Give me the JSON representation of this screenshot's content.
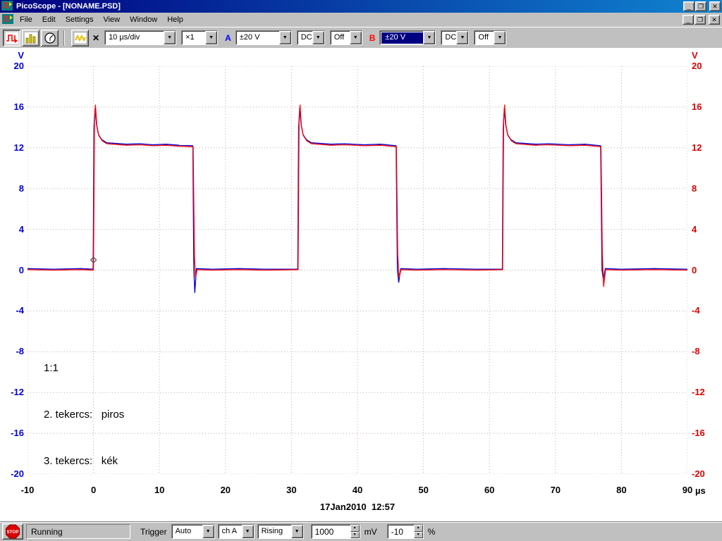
{
  "window": {
    "title": "PicoScope - [NONAME.PSD]",
    "minimize_glyph": "_",
    "restore_glyph": "❐",
    "close_glyph": "✕"
  },
  "menu": {
    "items": [
      "File",
      "Edit",
      "Settings",
      "View",
      "Window",
      "Help"
    ]
  },
  "toolbar": {
    "x_label": "✕",
    "timebase": "10 µs/div",
    "multiplier": "×1",
    "channel_a": {
      "label": "A",
      "range": "±20 V",
      "coupling": "DC",
      "mode": "Off"
    },
    "channel_b": {
      "label": "B",
      "range": "±20 V",
      "coupling": "DC",
      "mode": "Off"
    }
  },
  "scope": {
    "left_axis_unit": "V",
    "right_axis_unit": "V",
    "x_axis_unit": "µs",
    "timestamp": "17Jan2010  12:57",
    "annotation_lines": [
      "1:1",
      "2. tekercs:   piros",
      "3. tekercs:   kék"
    ]
  },
  "statusbar": {
    "stop_label": "STOP",
    "status": "Running",
    "trigger_label": "Trigger",
    "trigger_mode": "Auto",
    "trigger_source": "ch A",
    "trigger_direction": "Rising",
    "trigger_threshold": "1000",
    "threshold_unit": "mV",
    "trigger_delay": "-10",
    "delay_unit": "%"
  },
  "ui": {
    "dropdown_arrow": "▼",
    "spin_up": "▲",
    "spin_down": "▼",
    "titlebar_gradient": [
      "#000080",
      "#1084d0"
    ],
    "channel_a_color": "#0000ff",
    "channel_b_color": "#ff0000",
    "grid_color": "#c9a9a9"
  },
  "chart_data": {
    "type": "line",
    "title": "",
    "xlabel": "µs",
    "ylabel": "V",
    "xlim": [
      -10,
      90
    ],
    "ylim": [
      -20,
      20
    ],
    "x_ticks": [
      -10,
      0,
      10,
      20,
      30,
      40,
      50,
      60,
      70,
      80,
      90
    ],
    "y_ticks": [
      20,
      16,
      12,
      8,
      4,
      0,
      -4,
      -8,
      -12,
      -16,
      -20
    ],
    "grid": "dotted",
    "legend": "none",
    "trigger_marker": {
      "x": 0,
      "y": 1
    },
    "series": [
      {
        "name": "3. tekercs (kék)",
        "color": "#0000cc",
        "points": [
          [
            -10,
            0.15
          ],
          [
            -6,
            0.1
          ],
          [
            -2,
            0.15
          ],
          [
            -0.05,
            0.1
          ],
          [
            0.08,
            14
          ],
          [
            0.25,
            15.9
          ],
          [
            0.45,
            14.3
          ],
          [
            0.75,
            13.3
          ],
          [
            1.25,
            12.8
          ],
          [
            2,
            12.5
          ],
          [
            3,
            12.45
          ],
          [
            5,
            12.35
          ],
          [
            7,
            12.4
          ],
          [
            9,
            12.3
          ],
          [
            11,
            12.35
          ],
          [
            13,
            12.25
          ],
          [
            15.05,
            12.2
          ],
          [
            15.2,
            0
          ],
          [
            15.35,
            -2.2
          ],
          [
            15.6,
            0.15
          ],
          [
            18,
            0.1
          ],
          [
            22,
            0.15
          ],
          [
            26,
            0.1
          ],
          [
            30.95,
            0.1
          ],
          [
            31.08,
            14
          ],
          [
            31.25,
            15.9
          ],
          [
            31.45,
            14.3
          ],
          [
            31.75,
            13.3
          ],
          [
            32.25,
            12.8
          ],
          [
            33,
            12.5
          ],
          [
            34,
            12.45
          ],
          [
            36,
            12.35
          ],
          [
            38,
            12.4
          ],
          [
            41,
            12.3
          ],
          [
            43.5,
            12.35
          ],
          [
            45.85,
            12.2
          ],
          [
            46.05,
            0
          ],
          [
            46.25,
            -1.2
          ],
          [
            46.55,
            0.15
          ],
          [
            49,
            0.1
          ],
          [
            53,
            0.15
          ],
          [
            58,
            0.1
          ],
          [
            61.95,
            0.1
          ],
          [
            62.08,
            14
          ],
          [
            62.25,
            15.9
          ],
          [
            62.45,
            14.3
          ],
          [
            62.75,
            13.3
          ],
          [
            63.25,
            12.8
          ],
          [
            64,
            12.5
          ],
          [
            65,
            12.45
          ],
          [
            67,
            12.35
          ],
          [
            69,
            12.4
          ],
          [
            72,
            12.3
          ],
          [
            74.5,
            12.35
          ],
          [
            76.85,
            12.2
          ],
          [
            77.05,
            0
          ],
          [
            77.25,
            -0.9
          ],
          [
            77.55,
            0.15
          ],
          [
            80,
            0.1
          ],
          [
            85,
            0.15
          ],
          [
            90,
            0.1
          ]
        ]
      },
      {
        "name": "2. tekercs (piros)",
        "color": "#ff0000",
        "points": [
          [
            -10,
            0.05
          ],
          [
            -6,
            0
          ],
          [
            -2,
            0.05
          ],
          [
            0,
            0
          ],
          [
            0.15,
            14.5
          ],
          [
            0.3,
            16.2
          ],
          [
            0.5,
            14.2
          ],
          [
            0.8,
            13.2
          ],
          [
            1.3,
            12.7
          ],
          [
            2,
            12.4
          ],
          [
            3,
            12.35
          ],
          [
            5,
            12.25
          ],
          [
            7,
            12.3
          ],
          [
            9,
            12.2
          ],
          [
            11,
            12.25
          ],
          [
            13,
            12.15
          ],
          [
            15.1,
            12.1
          ],
          [
            15.3,
            1.5
          ],
          [
            15.45,
            -0.7
          ],
          [
            15.7,
            0.05
          ],
          [
            18,
            0
          ],
          [
            22,
            0.05
          ],
          [
            26,
            0
          ],
          [
            31,
            0.05
          ],
          [
            31.15,
            14.5
          ],
          [
            31.3,
            16.2
          ],
          [
            31.5,
            14.2
          ],
          [
            31.8,
            13.2
          ],
          [
            32.3,
            12.7
          ],
          [
            33,
            12.4
          ],
          [
            34,
            12.35
          ],
          [
            36,
            12.25
          ],
          [
            38,
            12.3
          ],
          [
            41,
            12.2
          ],
          [
            43.5,
            12.25
          ],
          [
            45.9,
            12.1
          ],
          [
            46.1,
            1.5
          ],
          [
            46.3,
            -0.7
          ],
          [
            46.6,
            0.05
          ],
          [
            49,
            0
          ],
          [
            53,
            0.05
          ],
          [
            58,
            0
          ],
          [
            62,
            0.05
          ],
          [
            62.15,
            14.5
          ],
          [
            62.3,
            16.2
          ],
          [
            62.5,
            14.2
          ],
          [
            62.8,
            13.2
          ],
          [
            63.3,
            12.7
          ],
          [
            64,
            12.4
          ],
          [
            65,
            12.35
          ],
          [
            67,
            12.25
          ],
          [
            69,
            12.3
          ],
          [
            72,
            12.2
          ],
          [
            74.5,
            12.25
          ],
          [
            76.9,
            12.1
          ],
          [
            77.1,
            1.5
          ],
          [
            77.3,
            -1.6
          ],
          [
            77.6,
            0.05
          ],
          [
            80,
            0
          ],
          [
            85,
            0.05
          ],
          [
            90,
            0
          ]
        ]
      }
    ]
  }
}
